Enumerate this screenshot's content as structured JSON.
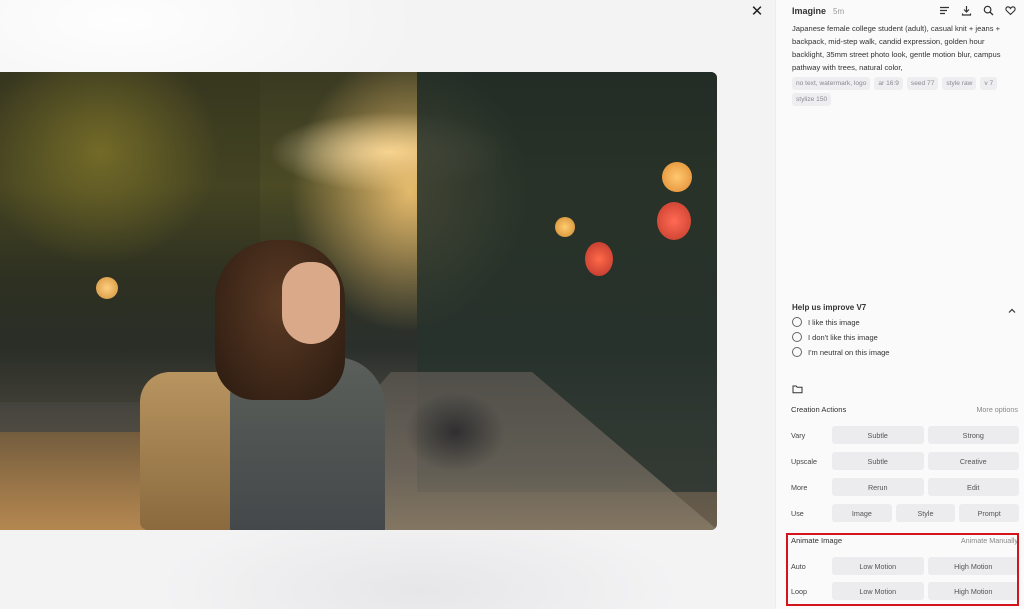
{
  "header": {
    "title": "Imagine",
    "age": "5m"
  },
  "header_icons": [
    "menu-lines-icon",
    "download-icon",
    "search-icon",
    "heart-icon"
  ],
  "close_label": "✕",
  "prompt": "Japanese female college student (adult), casual knit + jeans + backpack, mid-step walk, candid expression, golden hour backlight, 35mm street photo look, gentle motion blur, campus pathway with trees, natural color,",
  "tags": [
    "no text, watermark, logo",
    "ar 16:9",
    "seed 77",
    "style raw",
    "v 7",
    "stylize 150"
  ],
  "feedback": {
    "heading": "Help us improve V7",
    "options": [
      "I like this image",
      "I don't like this image",
      "I'm neutral on this image"
    ]
  },
  "creation_actions": {
    "heading": "Creation Actions",
    "more": "More options",
    "rows": [
      {
        "label": "Vary",
        "buttons": [
          "Subtle",
          "Strong"
        ]
      },
      {
        "label": "Upscale",
        "buttons": [
          "Subtle",
          "Creative"
        ]
      },
      {
        "label": "More",
        "buttons": [
          "Rerun",
          "Edit"
        ]
      },
      {
        "label": "Use",
        "buttons": [
          "Image",
          "Style",
          "Prompt"
        ]
      }
    ]
  },
  "animate": {
    "heading": "Animate Image",
    "manual": "Animate Manually",
    "rows": [
      {
        "label": "Auto",
        "buttons": [
          "Low Motion",
          "High Motion"
        ]
      },
      {
        "label": "Loop",
        "buttons": [
          "Low Motion",
          "High Motion"
        ]
      }
    ]
  },
  "colors": {
    "highlight": "#d4141c",
    "panel_bg": "#fafafb",
    "button_bg": "#ececee"
  }
}
